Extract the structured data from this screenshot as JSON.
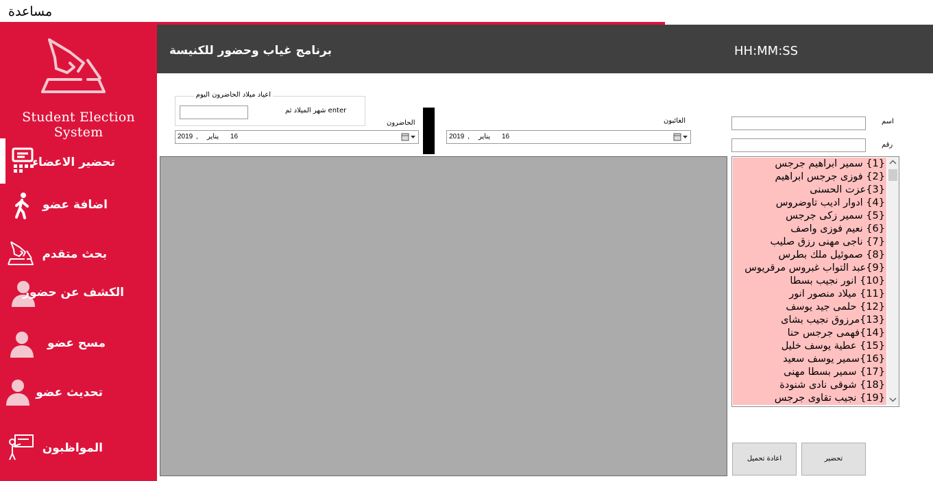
{
  "menu": {
    "help": "مساعدة"
  },
  "sidebar": {
    "title": "Student Election System",
    "items": [
      {
        "label": "تحضير الاعضاء",
        "icon": "attendance-icon"
      },
      {
        "label": "اضافة عضو",
        "icon": "walking-person-icon"
      },
      {
        "label": "بحث متقدم",
        "icon": "ballot-box-icon"
      },
      {
        "label": "الكشف عن حضور",
        "icon": "user-icon"
      },
      {
        "label": "مسح عضو",
        "icon": "user-icon"
      },
      {
        "label": "تحديث عضو",
        "icon": "user-icon"
      },
      {
        "label": "المواظبون",
        "icon": "teacher-board-icon"
      }
    ]
  },
  "header": {
    "title": "برنامج غياب وحضور للكنيسة",
    "clock": "HH:MM:SS"
  },
  "birthdays": {
    "group_title": "اعياد ميلاد الحاضرون اليوم",
    "input_label": "شهر الميلاد ثم enter",
    "input_value": ""
  },
  "present": {
    "label": "الحاضرون",
    "date": {
      "year": "2019",
      "sep": ",",
      "month": "يناير",
      "day": "16"
    }
  },
  "absent": {
    "label": "الغائبون",
    "date": {
      "year": "2019",
      "sep": ",",
      "month": "يناير",
      "day": "16"
    }
  },
  "form": {
    "name_label": "اسم",
    "name_value": "",
    "number_label": "رقم",
    "number_value": ""
  },
  "members": [
    "{1} سمير ابراهيم جرجس",
    "{2} فوزى جرجس ابراهيم",
    "{3}عزت الحسنى",
    "{4} ادوار اديب تاوضروس",
    "{5} سمير زكى جرجس",
    "{6} نعيم فوزى واصف",
    "{7} ناجى مهنى رزق صليب",
    "{8} صموئيل ملك بطرس",
    "{9}عبد التواب غبروس مرقريوس",
    "{10} انور نجيب بسطا",
    "{11}  ميلاد منصور انور",
    "{12} حلمى جيد يوسف",
    "{13}مرزوق نجيب بشاى",
    "{14}فهمى جرجس حنا",
    "{15} عطية يوسف خليل",
    "{16}سمير يوسف سعيد",
    "{17} سمير بسطا مهنى",
    "{18} شوقى نادى شنودة",
    "{19} نجيب تقاوى جرجس"
  ],
  "buttons": {
    "reload": "اعادة تحميل",
    "attend": "تحضير"
  },
  "colors": {
    "sidebar": "#dc143c",
    "header": "#404040",
    "list_background": "#ffc0c0",
    "grid_background": "#ababab"
  }
}
